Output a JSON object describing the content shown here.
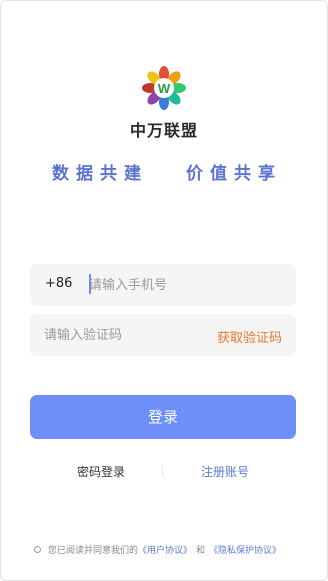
{
  "brand": {
    "logo_icon": "flower-w-logo-icon",
    "logo_letter": "W",
    "app_name": "中万联盟",
    "slogan_left": "数据共建",
    "slogan_right": "价值共享",
    "slogan_color": "#5b74cf"
  },
  "phone": {
    "prefix": "+86",
    "placeholder": "请输入手机号",
    "value": ""
  },
  "code": {
    "placeholder": "请输入验证码",
    "value": "",
    "get_code_label": "获取验证码",
    "get_code_color": "#e9772d"
  },
  "login": {
    "button_label": "登录",
    "button_color": "#6e8ff8"
  },
  "links": {
    "password_login": "密码登录",
    "register": "注册账号"
  },
  "agreement": {
    "prefix_text": "您已阅读并同意我们的",
    "user_agreement": "《用户协议》",
    "conjunction": "和",
    "privacy_agreement": "《隐私保护协议》",
    "checked": false
  }
}
